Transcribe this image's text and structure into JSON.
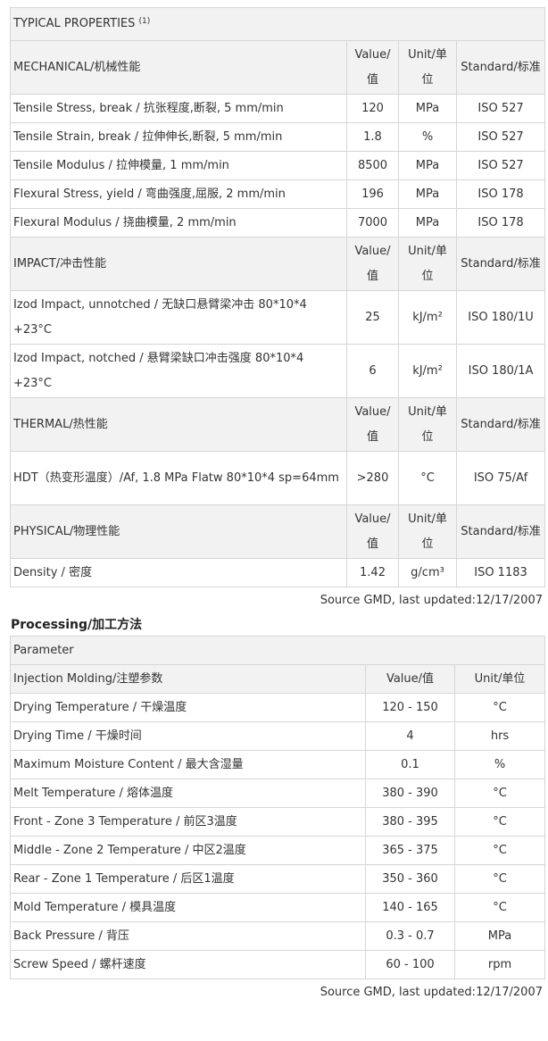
{
  "properties": {
    "title": "TYPICAL PROPERTIES",
    "title_sup": "(1)",
    "sections": [
      {
        "name": "MECHANICAL/机械性能",
        "col_value": "Value/值",
        "col_unit": "Unit/单位",
        "col_standard": "Standard/标准",
        "rows": [
          {
            "name": "Tensile Stress, break / 抗张程度,断裂, 5 mm/min",
            "value": "120",
            "unit": "MPa",
            "standard": "ISO 527"
          },
          {
            "name": "Tensile Strain, break / 拉伸伸长,断裂, 5 mm/min",
            "value": "1.8",
            "unit": "%",
            "standard": "ISO 527"
          },
          {
            "name": "Tensile Modulus / 拉伸模量, 1 mm/min",
            "value": "8500",
            "unit": "MPa",
            "standard": "ISO 527"
          },
          {
            "name": "Flexural Stress, yield / 弯曲强度,屈服, 2 mm/min",
            "value": "196",
            "unit": "MPa",
            "standard": "ISO 178"
          },
          {
            "name": "Flexural Modulus / 挠曲模量, 2 mm/min",
            "value": "7000",
            "unit": "MPa",
            "standard": "ISO 178"
          }
        ]
      },
      {
        "name": "IMPACT/冲击性能",
        "col_value": "Value/值",
        "col_unit": "Unit/单位",
        "col_standard": "Standard/标准",
        "rows": [
          {
            "name": "Izod Impact, unnotched / 无缺口悬臂梁冲击 80*10*4 +23°C",
            "value": "25",
            "unit": "kJ/m²",
            "standard": "ISO 180/1U"
          },
          {
            "name": "Izod Impact, notched / 悬臂梁缺口冲击强度 80*10*4 +23°C",
            "value": "6",
            "unit": "kJ/m²",
            "standard": "ISO 180/1A"
          }
        ]
      },
      {
        "name": "THERMAL/热性能",
        "col_value": "Value/值",
        "col_unit": "Unit/单位",
        "col_standard": "Standard/标准",
        "rows": [
          {
            "name": "HDT（热变形温度）/Af, 1.8 MPa Flatw 80*10*4 sp=64mm",
            "value": ">280",
            "unit": "°C",
            "standard": "ISO 75/Af"
          }
        ]
      },
      {
        "name": "PHYSICAL/物理性能",
        "col_value": "Value/值",
        "col_unit": "Unit/单位",
        "col_standard": "Standard/标准",
        "rows": [
          {
            "name": "Density / 密度",
            "value": "1.42",
            "unit": "g/cm³",
            "standard": "ISO 1183"
          }
        ]
      }
    ],
    "source": "Source GMD, last updated:12/17/2007"
  },
  "processing": {
    "heading": "Processing/加工方法",
    "parameter_label": "Parameter",
    "section_name": "Injection Molding/注塑参数",
    "col_value": "Value/值",
    "col_unit": "Unit/单位",
    "rows": [
      {
        "name": "Drying Temperature / 干燥温度",
        "value": "120 - 150",
        "unit": "°C"
      },
      {
        "name": "Drying Time / 干燥时间",
        "value": "4",
        "unit": "hrs"
      },
      {
        "name": "Maximum Moisture Content / 最大含湿量",
        "value": "0.1",
        "unit": "%"
      },
      {
        "name": "Melt Temperature / 熔体温度",
        "value": "380 - 390",
        "unit": "°C"
      },
      {
        "name": "Front - Zone 3 Temperature / 前区3温度",
        "value": "380 - 395",
        "unit": "°C"
      },
      {
        "name": "Middle - Zone 2 Temperature / 中区2温度",
        "value": "365 - 375",
        "unit": "°C"
      },
      {
        "name": "Rear - Zone 1 Temperature / 后区1温度",
        "value": "350 - 360",
        "unit": "°C"
      },
      {
        "name": "Mold Temperature / 模具温度",
        "value": "140 - 165",
        "unit": "°C"
      },
      {
        "name": "Back Pressure / 背压",
        "value": "0.3 - 0.7",
        "unit": "MPa"
      },
      {
        "name": "Screw Speed / 螺杆速度",
        "value": "60 - 100",
        "unit": "rpm"
      }
    ],
    "source": "Source GMD, last updated:12/17/2007"
  }
}
